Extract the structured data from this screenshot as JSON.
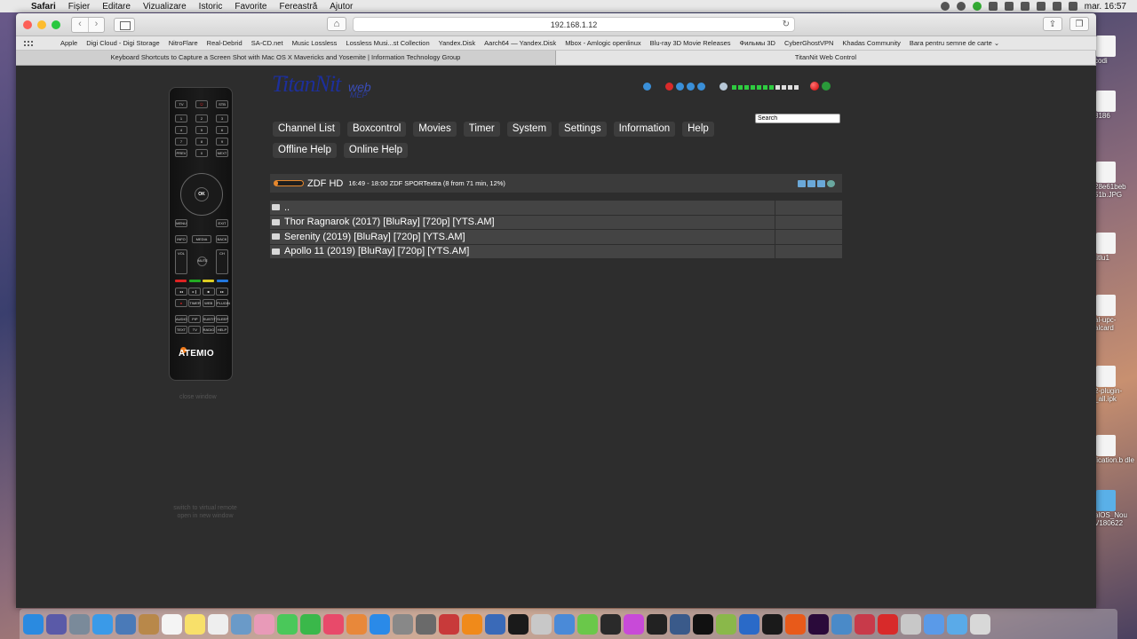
{
  "menubar": {
    "items": [
      "Safari",
      "Fișier",
      "Editare",
      "Vizualizare",
      "Istoric",
      "Favorite",
      "Fereastră",
      "Ajutor"
    ],
    "clock": "mar. 16:57"
  },
  "browser": {
    "url": "192.168.1.12",
    "bookmarks": [
      "Apple",
      "Digi Cloud - Digi Storage",
      "NitroFlare",
      "Real-Debrid",
      "SA-CD.net",
      "Music Lossless",
      "Lossless Musi...st Collection",
      "Yandex.Disk",
      "Aarch64 — Yandex.Disk",
      "Mbox - Amlogic openlinux",
      "Blu-ray 3D Movie Releases",
      "Фильмы 3D",
      "CyberGhostVPN",
      "Khadas Community",
      "Bara pentru semne de carte ⌄"
    ],
    "tabs": [
      "Keyboard Shortcuts to Capture a Screen Shot with Mac OS X Mavericks and Yosemite | Information Technology Group",
      "TitanNit Web Control"
    ]
  },
  "desktop_icons": [
    "codi",
    "8186",
    "28e61beb 51b.JPG",
    "titlu1",
    "al-upc- alcard",
    "2-plugin- _all.ipk",
    "fication.b dle",
    "alOS_Nou V180622"
  ],
  "remote": {
    "brand": "ATEMIO",
    "keys": {
      "tv": "TV",
      "stb": "STB",
      "ok": "OK",
      "prev": "PREV",
      "next": "NEXT",
      "menu": "MENU",
      "exit": "EXIT",
      "info": "INFO",
      "media": "MEDIA",
      "back": "BACK",
      "vol": "VOL",
      "mute": "MUTE",
      "ch": "CH",
      "timer": "TIMER",
      "web": "WEB",
      "plugin": "PLUGIN",
      "audio": "AUDIO",
      "pip": "PIP",
      "subtitle": "SUBTITLE",
      "sleep": "SLEEP",
      "text": "TEXT",
      "tvk": "TV",
      "radio": "RADIO",
      "help": "HELP"
    },
    "close_window": "close window",
    "switch_line1": "switch to virtual remote",
    "switch_line2": "open in new window"
  },
  "logo": {
    "main": "TitanNit",
    "web": "web",
    "sub": "MEP"
  },
  "search": {
    "value": "Search"
  },
  "nav": {
    "row1": [
      "Channel List",
      "Boxcontrol",
      "Movies",
      "Timer",
      "System",
      "Settings",
      "Information",
      "Help"
    ],
    "row2": [
      "Offline Help",
      "Online Help"
    ]
  },
  "channel": {
    "name": "ZDF HD",
    "info": "16:49 - 18:00 ZDF SPORTextra (8 from 71 min, 12%)",
    "progress_percent": 12
  },
  "files": {
    "up": "..",
    "items": [
      "Thor Ragnarok (2017) [BluRay] [720p] [YTS.AM]",
      "Serenity (2019) [BluRay] [720p] [YTS.AM]",
      "Apollo 11 (2019) [BluRay] [720p] [YTS.AM]"
    ]
  },
  "signal": {
    "strength_filled": 7,
    "total": 11
  }
}
